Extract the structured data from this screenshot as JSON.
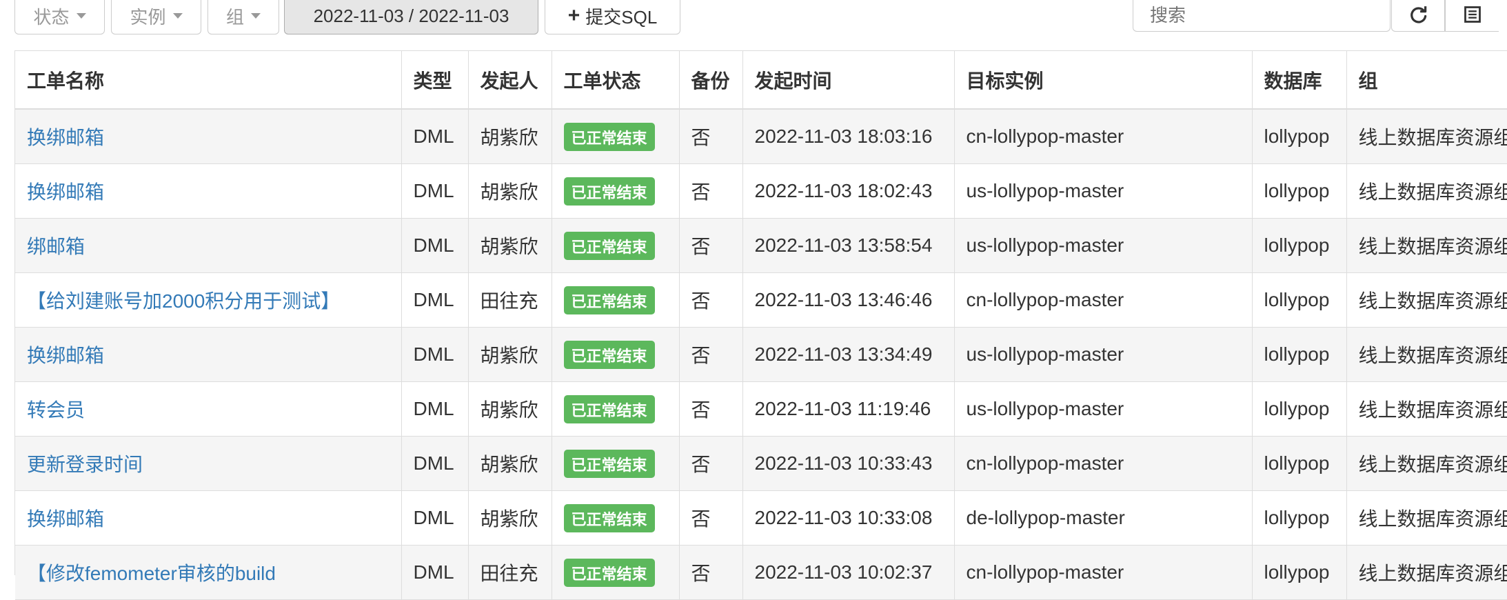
{
  "toolbar": {
    "status_label": "状态",
    "instance_label": "实例",
    "group_label": "组",
    "date_range": "2022-11-03 / 2022-11-03",
    "submit_label": "提交SQL",
    "search_placeholder": "搜索",
    "refresh_icon": "refresh-icon",
    "columns_icon": "list-icon"
  },
  "colors": {
    "link": "#337ab7",
    "badge_success": "#5cb85c"
  },
  "table": {
    "headers": [
      "工单名称",
      "类型",
      "发起人",
      "工单状态",
      "备份",
      "发起时间",
      "目标实例",
      "数据库",
      "组"
    ],
    "rows": [
      {
        "name": "换绑邮箱",
        "type": "DML",
        "initiator": "胡紫欣",
        "status": "已正常结束",
        "backup": "否",
        "time": "2022-11-03 18:03:16",
        "instance": "cn-lollypop-master",
        "db": "lollypop",
        "group": "线上数据库资源组"
      },
      {
        "name": "换绑邮箱",
        "type": "DML",
        "initiator": "胡紫欣",
        "status": "已正常结束",
        "backup": "否",
        "time": "2022-11-03 18:02:43",
        "instance": "us-lollypop-master",
        "db": "lollypop",
        "group": "线上数据库资源组"
      },
      {
        "name": "绑邮箱",
        "type": "DML",
        "initiator": "胡紫欣",
        "status": "已正常结束",
        "backup": "否",
        "time": "2022-11-03 13:58:54",
        "instance": "us-lollypop-master",
        "db": "lollypop",
        "group": "线上数据库资源组"
      },
      {
        "name": "【给刘建账号加2000积分用于测试】",
        "type": "DML",
        "initiator": "田往充",
        "status": "已正常结束",
        "backup": "否",
        "time": "2022-11-03 13:46:46",
        "instance": "cn-lollypop-master",
        "db": "lollypop",
        "group": "线上数据库资源组"
      },
      {
        "name": "换绑邮箱",
        "type": "DML",
        "initiator": "胡紫欣",
        "status": "已正常结束",
        "backup": "否",
        "time": "2022-11-03 13:34:49",
        "instance": "us-lollypop-master",
        "db": "lollypop",
        "group": "线上数据库资源组"
      },
      {
        "name": "转会员",
        "type": "DML",
        "initiator": "胡紫欣",
        "status": "已正常结束",
        "backup": "否",
        "time": "2022-11-03 11:19:46",
        "instance": "us-lollypop-master",
        "db": "lollypop",
        "group": "线上数据库资源组"
      },
      {
        "name": "更新登录时间",
        "type": "DML",
        "initiator": "胡紫欣",
        "status": "已正常结束",
        "backup": "否",
        "time": "2022-11-03 10:33:43",
        "instance": "cn-lollypop-master",
        "db": "lollypop",
        "group": "线上数据库资源组"
      },
      {
        "name": "换绑邮箱",
        "type": "DML",
        "initiator": "胡紫欣",
        "status": "已正常结束",
        "backup": "否",
        "time": "2022-11-03 10:33:08",
        "instance": "de-lollypop-master",
        "db": "lollypop",
        "group": "线上数据库资源组"
      },
      {
        "name": "【修改femometer审核的build",
        "type": "DML",
        "initiator": "田往充",
        "status": "已正常结束",
        "backup": "否",
        "time": "2022-11-03 10:02:37",
        "instance": "cn-lollypop-master",
        "db": "lollypop",
        "group": "线上数据库资源组"
      }
    ]
  }
}
